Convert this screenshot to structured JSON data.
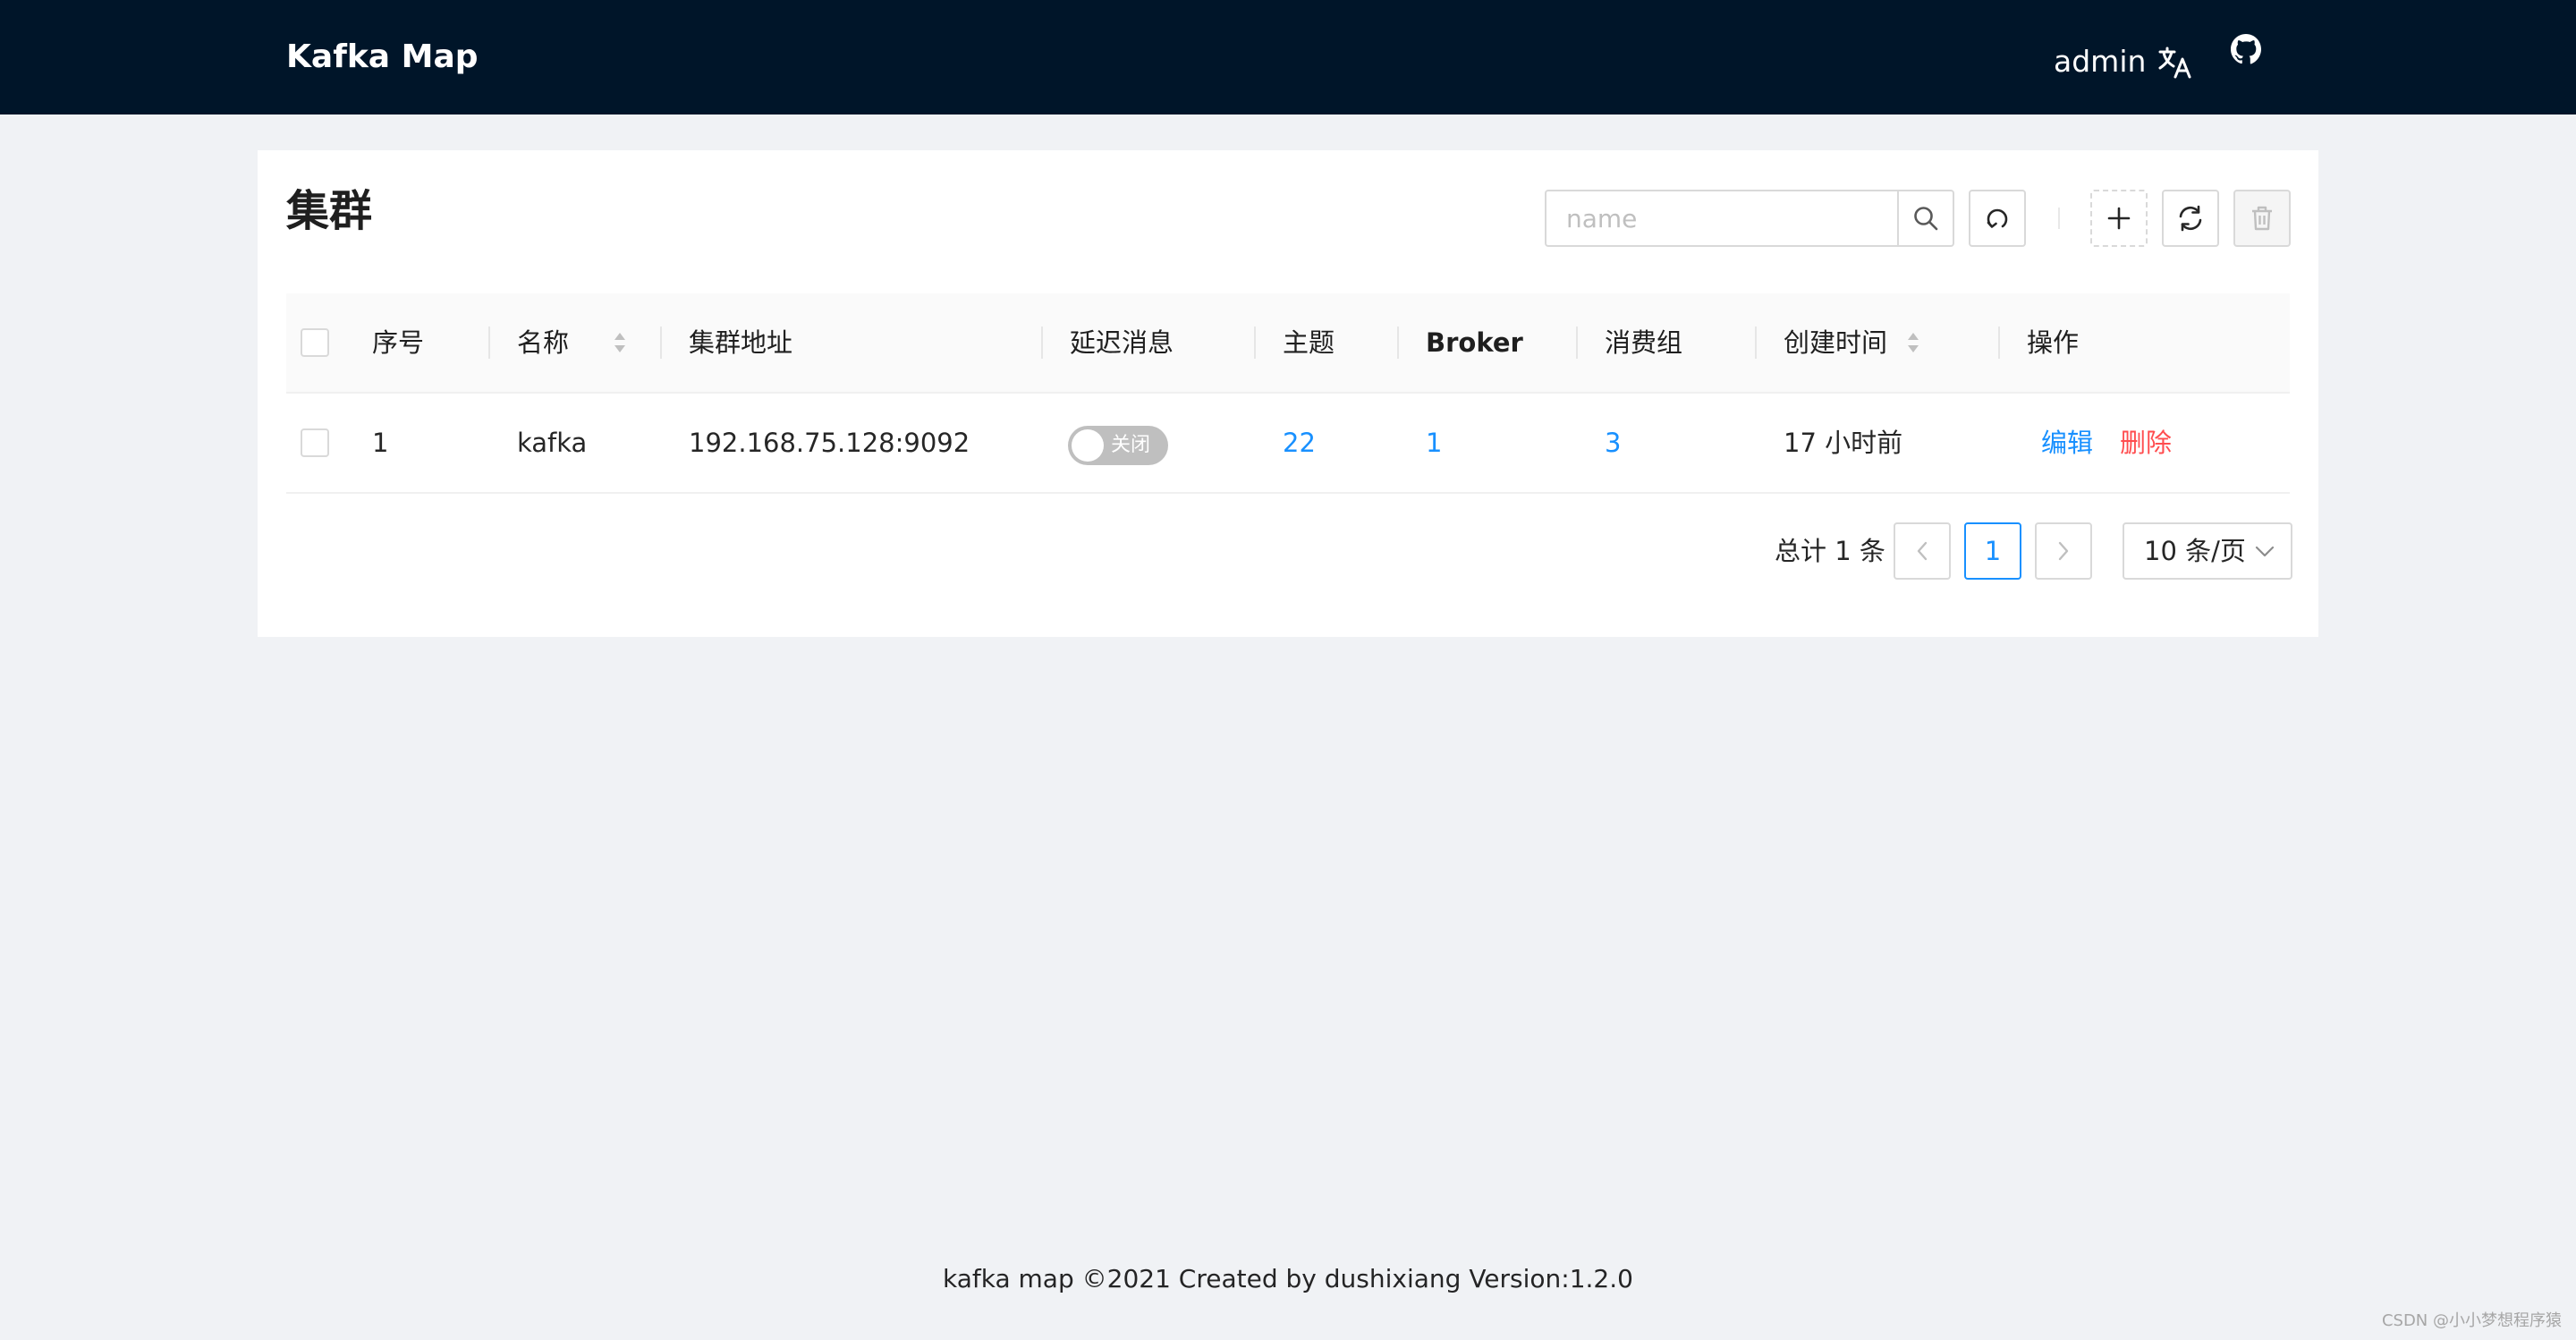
{
  "header": {
    "brand": "Kafka Map",
    "user": "admin",
    "translate_icon": "translate-icon",
    "github_icon": "github-icon",
    "background": "#001529"
  },
  "page": {
    "title": "集群",
    "search": {
      "placeholder": "name",
      "value": ""
    },
    "toolbar": {
      "search_icon": "search-icon",
      "reset_icon": "reset-icon",
      "add_icon": "plus-icon",
      "refresh_icon": "sync-icon",
      "delete_icon": "trash-icon"
    }
  },
  "table": {
    "columns": [
      "序号",
      "名称",
      "集群地址",
      "延迟消息",
      "主题",
      "Broker",
      "消费组",
      "创建时间",
      "操作"
    ],
    "rows": [
      {
        "index": "1",
        "name": "kafka",
        "address": "192.168.75.128:9092",
        "delay_switch": "关闭",
        "delay_enabled": false,
        "topics": "22",
        "brokers": "1",
        "consumer_groups": "3",
        "created": "17 小时前",
        "actions": [
          "编辑",
          "删除"
        ]
      }
    ]
  },
  "pagination": {
    "total": "总计 1 条",
    "current_page": "1",
    "page_size": "10 条/页"
  },
  "footer": {
    "text": "kafka map ©2021 Created by dushixiang Version:1.2.0"
  },
  "watermark": "CSDN @小小梦想程序猿",
  "colors": {
    "accent": "#1890ff",
    "danger": "#ff4d4f",
    "page_bg": "#f0f2f5"
  }
}
